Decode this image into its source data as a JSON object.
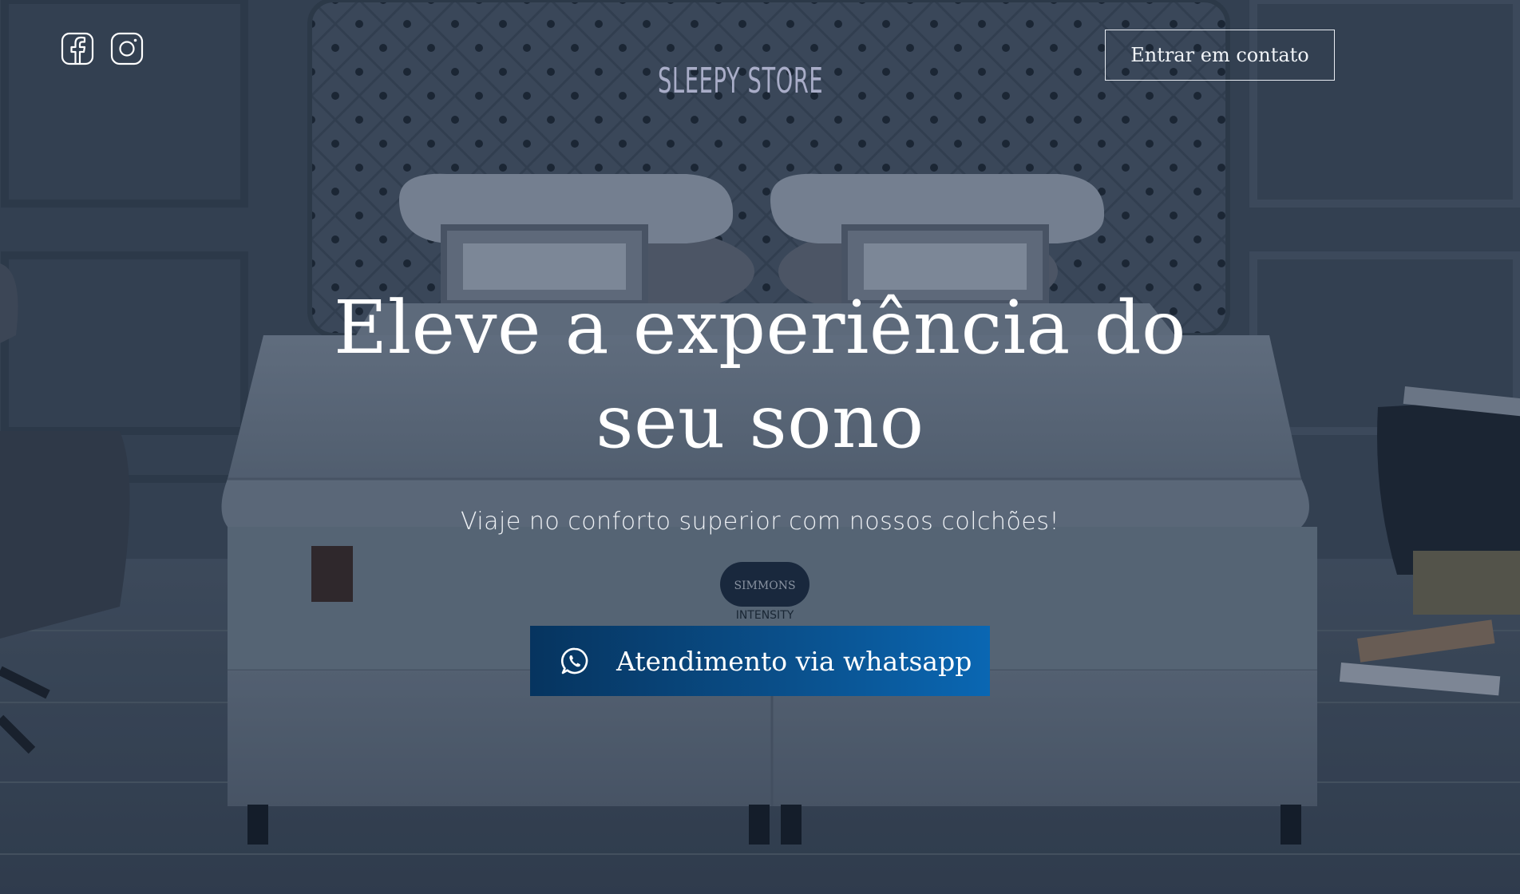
{
  "social": {
    "items": [
      {
        "name": "facebook",
        "icon": "facebook-icon"
      },
      {
        "name": "instagram",
        "icon": "instagram-icon"
      }
    ]
  },
  "brand": {
    "logo_text": "SLEEPY STORE",
    "logo_color": "#a9adc8"
  },
  "header": {
    "contact_label": "Entrar em contato"
  },
  "hero": {
    "headline_line1": "Eleve a experiência do",
    "headline_line2": "seu sono",
    "subtitle": "Viaje no conforto superior com nossos colchões!",
    "cta_label": "Atendimento via whatsapp",
    "cta_icon": "whatsapp-icon",
    "background_image": "bedroom-bed-photo",
    "mattress_label_brand": "SIMMONS",
    "mattress_label_model": "INTENSITY"
  },
  "colors": {
    "cta_gradient_start": "#06345f",
    "cta_gradient_end": "#0a67b3",
    "overlay": "#1f2f43"
  }
}
